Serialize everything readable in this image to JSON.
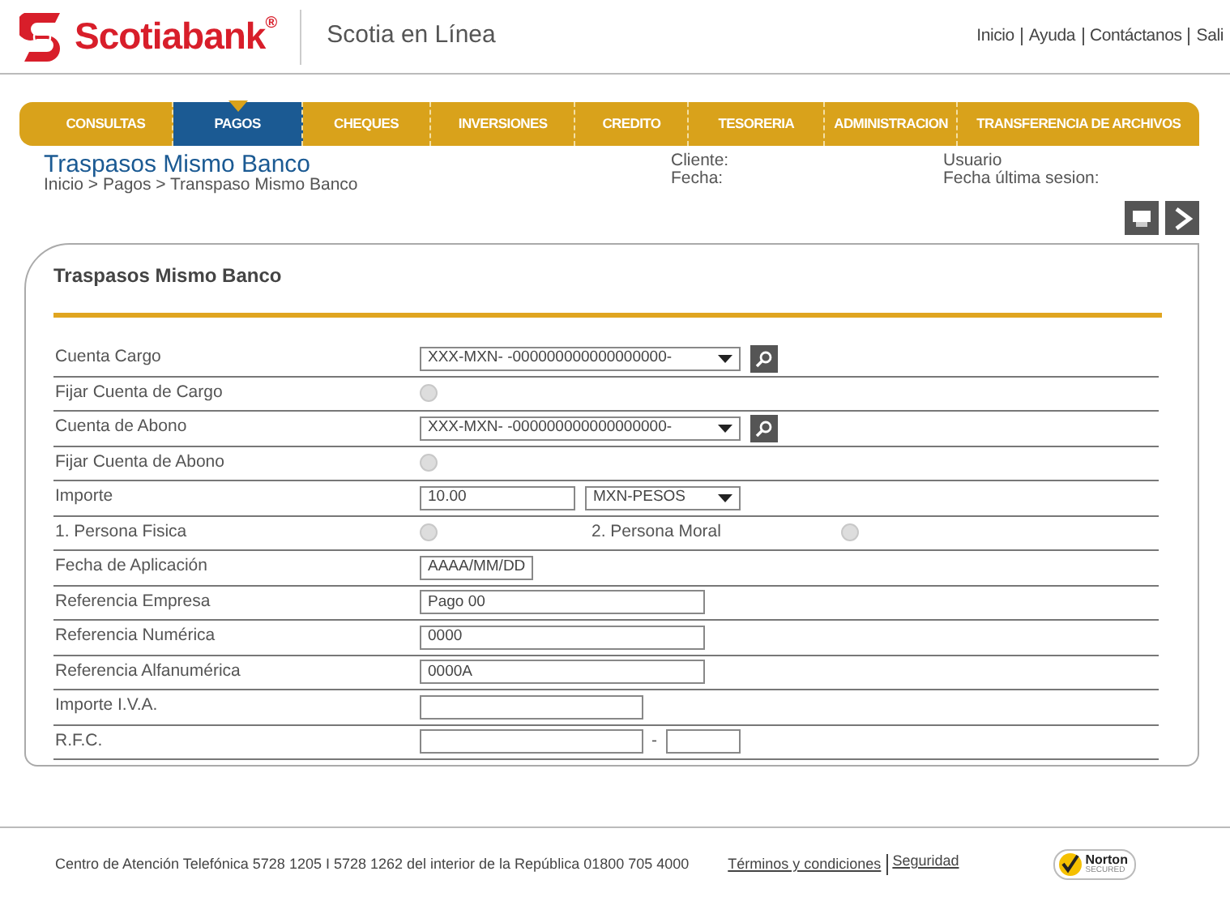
{
  "brand": {
    "name": "Scotiabank$^{®}$",
    "product": "Scotia en Línea"
  },
  "top_links": [
    "Inicio",
    "Ayuda",
    "Contáctanos",
    "Sali"
  ],
  "nav": [
    {
      "label": "CONSULTAS",
      "selected": false
    },
    {
      "label": "PAGOS",
      "selected": true
    },
    {
      "label": "CHEQUES",
      "selected": false
    },
    {
      "label": "INVERSIONES",
      "selected": false
    },
    {
      "label": "CREDITO",
      "selected": false
    },
    {
      "label": "TESORERIA",
      "selected": false
    },
    {
      "label": "ADMINISTRACION",
      "selected": false
    },
    {
      "label": "TRANSFERENCIA DE ARCHIVOS",
      "selected": false
    }
  ],
  "page": {
    "title": "Traspasos Mismo Banco",
    "breadcrumb": "Inicio > Pagos > Transpaso Mismo Banco",
    "client_label": "Cliente:",
    "date_label": "Fecha:",
    "user_label": "Usuario",
    "last_session_label": "Fecha última sesion:"
  },
  "form": {
    "title": "Traspasos Mismo Banco",
    "rows": [
      {
        "kind": "account",
        "label": "Cuenta Cargo",
        "value": "XXX-MXN-  -000000000000000000-"
      },
      {
        "kind": "radio",
        "label": "Fijar Cuenta de Cargo",
        "checked": false
      },
      {
        "kind": "account",
        "label": "Cuenta de Abono",
        "value": "XXX-MXN-  -000000000000000000-"
      },
      {
        "kind": "radio",
        "label": "Fijar Cuenta de Abono",
        "checked": false
      },
      {
        "kind": "amount",
        "label": "Importe",
        "value": "10.00",
        "currency": "MXN-PESOS"
      },
      {
        "kind": "pair",
        "label": "1. Persona Fisica",
        "checked": false,
        "second_label": "2. Persona Moral",
        "second_checked": false
      },
      {
        "kind": "date",
        "label": "Fecha de Aplicación",
        "value": "AAAA/MM/DD"
      },
      {
        "kind": "text",
        "label": "Referencia Empresa",
        "value": "Pago 00"
      },
      {
        "kind": "text",
        "label": "Referencia Numérica",
        "value": "0000"
      },
      {
        "kind": "text",
        "label": "Referencia Alfanumérica",
        "value": "0000A"
      },
      {
        "kind": "short",
        "label": "Importe I.V.A."
      },
      {
        "kind": "rfc",
        "label": "R.F.C.",
        "separator": "-"
      }
    ]
  },
  "footer": {
    "text": "Centro de Atención Telefónica 5728 1205 I 5728 1262 del interior de la República 01800 705 4000",
    "links": [
      "Términos y condiciones",
      "Seguridad"
    ],
    "badge_title": "Norton",
    "badge_subtitle": "SECURED"
  }
}
